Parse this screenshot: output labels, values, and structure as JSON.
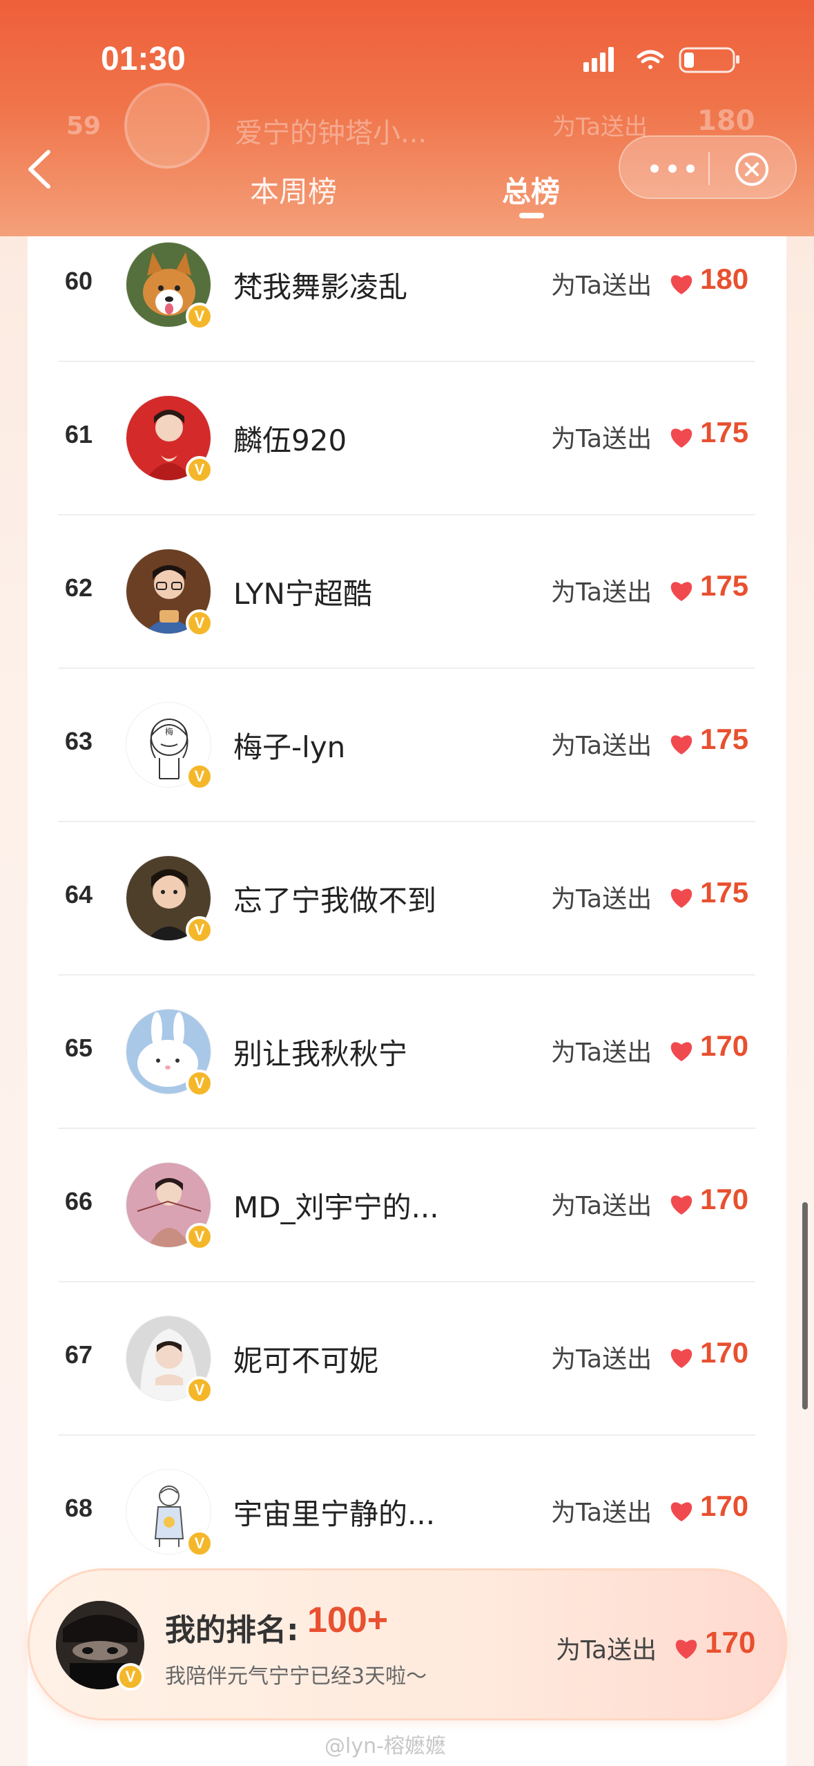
{
  "status_bar": {
    "time": "01:30"
  },
  "header": {
    "tabs": [
      {
        "label": "本周榜",
        "active": false
      },
      {
        "label": "总榜",
        "active": true
      }
    ],
    "ghost_row": {
      "rank": "59",
      "name": "爱宁的钟塔小...",
      "sent_label": "为Ta送出",
      "score": "180"
    }
  },
  "list": {
    "sent_label": "为Ta送出",
    "rows": [
      {
        "rank": "60",
        "name": "梵我舞影凌乱",
        "score": "180",
        "avatar_color": "#6f8a4a",
        "avatar": "corgi"
      },
      {
        "rank": "61",
        "name": "麟伍920",
        "score": "175",
        "avatar_color": "#d42a2a",
        "avatar": "person-red"
      },
      {
        "rank": "62",
        "name": "LYN宁超酷",
        "score": "175",
        "avatar_color": "#7a4a2c",
        "avatar": "person-glasses"
      },
      {
        "rank": "63",
        "name": "梅子-lyn",
        "score": "175",
        "avatar_color": "#ffffff",
        "avatar": "sketch-girl"
      },
      {
        "rank": "64",
        "name": "忘了宁我做不到",
        "score": "175",
        "avatar_color": "#5b4a33",
        "avatar": "person-dark"
      },
      {
        "rank": "65",
        "name": "别让我秋秋宁",
        "score": "170",
        "avatar_color": "#a9c8e8",
        "avatar": "rabbit"
      },
      {
        "rank": "66",
        "name": "MD_刘宇宁的...",
        "score": "170",
        "avatar_color": "#d7a8b8",
        "avatar": "person-pink"
      },
      {
        "rank": "67",
        "name": "妮可不可妮",
        "score": "170",
        "avatar_color": "#d9d9d9",
        "avatar": "person-veil"
      },
      {
        "rank": "68",
        "name": "宇宙里宁静的...",
        "score": "170",
        "avatar_color": "#ffffff",
        "avatar": "sketch-boy"
      }
    ]
  },
  "my_rank": {
    "label": "我的排名:",
    "rank": "100+",
    "subtitle": "我陪伴元气宁宁已经3天啦～",
    "sent_label": "为Ta送出",
    "score": "170"
  },
  "watermark": "@lyn-榕嬷嬷",
  "colors": {
    "accent": "#e8502f",
    "header": "#ee5f3a",
    "badge": "#f5b72a"
  }
}
